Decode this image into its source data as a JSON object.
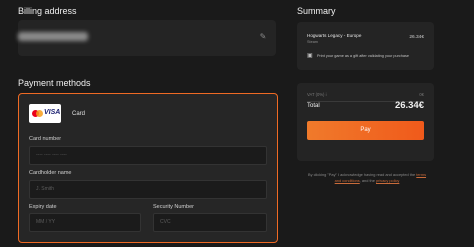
{
  "billing": {
    "title": "Billing address"
  },
  "payment": {
    "title": "Payment methods",
    "card_label": "Card",
    "card_brand_visa": "VISA",
    "fields": {
      "card_number_label": "Card number",
      "card_number_placeholder": "---- ---- ---- ----",
      "holder_label": "Cardholder name",
      "holder_placeholder": "J. Smith",
      "expiry_label": "Expiry date",
      "expiry_placeholder": "MM / YY",
      "security_label": "Security Number",
      "security_placeholder": "CVC"
    }
  },
  "summary": {
    "title": "Summary",
    "item": {
      "name": "Hogwarts Legacy - Europe",
      "store": "Steam",
      "price": "26.34€"
    },
    "gift_text": "Print your game as a gift after validating your purchase",
    "vat_label": "VAT (0%) i",
    "vat_value": "0€",
    "total_label": "Total",
    "total_value": "26.34€",
    "pay_label": "Pay",
    "legal_prefix": "By clicking \"Pay\" I acknowledge having read and accepted the",
    "legal_terms": "terms and conditions",
    "legal_and": ", and the",
    "legal_privacy": "privacy policy"
  },
  "colors": {
    "accent": "#ef6a24",
    "background": "#1a1a1a",
    "panel": "#242424"
  }
}
